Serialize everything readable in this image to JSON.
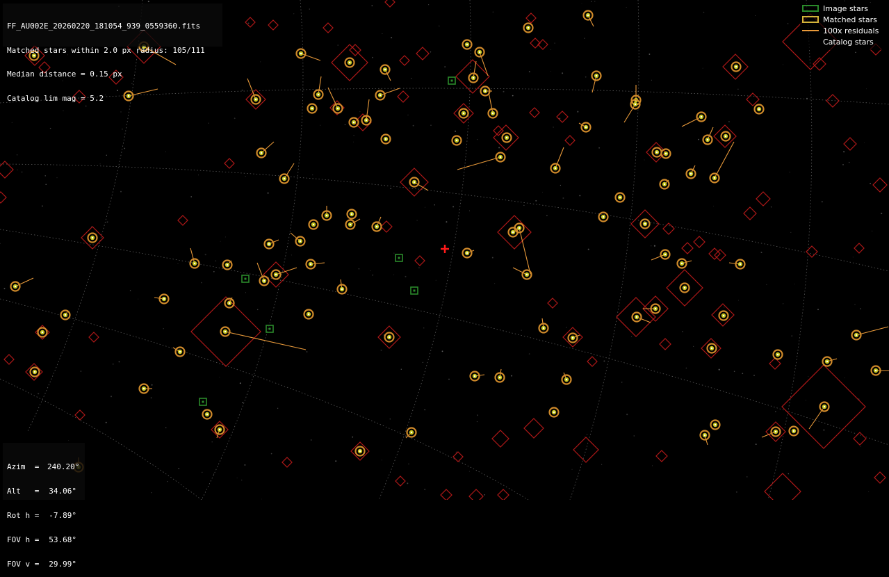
{
  "info": {
    "filename": "FF_AU002E_20260220_181054_939_0559360.fits",
    "matched_line": "Matched stars within 2.0 px radius: 105/111",
    "median_line": "Median distance = 0.15 px",
    "catalog_line": "Catalog lim mag = 5.2"
  },
  "pointing": [
    {
      "label": "Azim  =",
      "value": "240.20°"
    },
    {
      "label": "Alt   =",
      "value": "34.06°"
    },
    {
      "label": "Rot h =",
      "value": "-7.89°"
    },
    {
      "label": "FOV h =",
      "value": "53.68°"
    },
    {
      "label": "FOV v =",
      "value": "29.99°"
    }
  ],
  "legend": {
    "image_stars": "Image stars",
    "matched_stars": "Matched stars",
    "residuals": "100x residuals",
    "catalog_stars": "Catalog stars"
  },
  "colors": {
    "background": "#000000",
    "catalog_marker": "#b01818",
    "image_marker": "#2a8a2a",
    "matched_marker": "#d4b43a",
    "matched_fill": "#c8c820",
    "residual_line": "#e99a3a",
    "center_cross": "#ff1a1a",
    "grid_line": "#5a5a5a"
  }
}
